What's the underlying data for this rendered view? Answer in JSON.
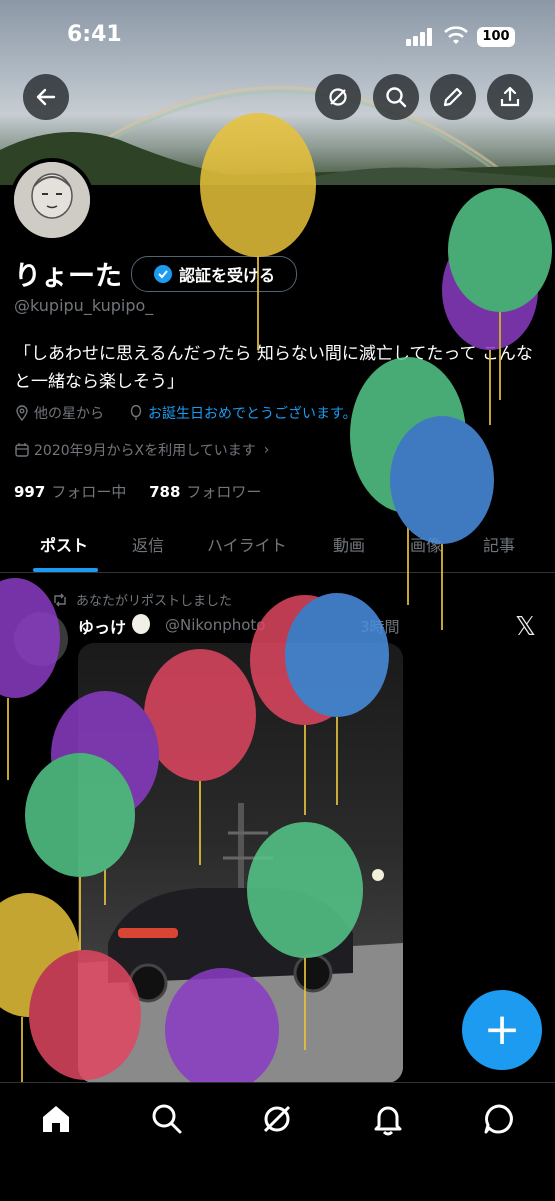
{
  "status_bar": {
    "time": "6:41",
    "battery": "100"
  },
  "profile": {
    "name": "りょーた",
    "verify_label": "認証を受ける",
    "handle": "@kupipu_kupipo_",
    "bio": "「しあわせに思えるんだったら 知らない間に滅亡してたって こんなと一緒なら楽しそう」",
    "location": "他の星から",
    "birthday": "お誕生日おめでとうございます。",
    "joined": "2020年9月からXを利用しています",
    "following_count": "997",
    "following_label": "フォロー中",
    "followers_count": "788",
    "followers_label": "フォロワー"
  },
  "tabs": [
    "ポスト",
    "返信",
    "ハイライト",
    "動画",
    "画像",
    "記事"
  ],
  "post": {
    "repost_label": "あなたがリポストしました",
    "author": "ゆっけ",
    "author_handle": "@Nikonphoto",
    "time": "3時間"
  },
  "fab_label": "+",
  "icons": {
    "back": "back-arrow-icon",
    "grok": "grok-icon",
    "search": "search-icon",
    "edit": "pencil-icon",
    "share": "share-icon",
    "nav": [
      "home-icon",
      "search-icon",
      "grok-icon",
      "bell-icon",
      "chat-icon"
    ]
  },
  "colors": {
    "accent": "#1d9bf0",
    "background": "#000000"
  }
}
